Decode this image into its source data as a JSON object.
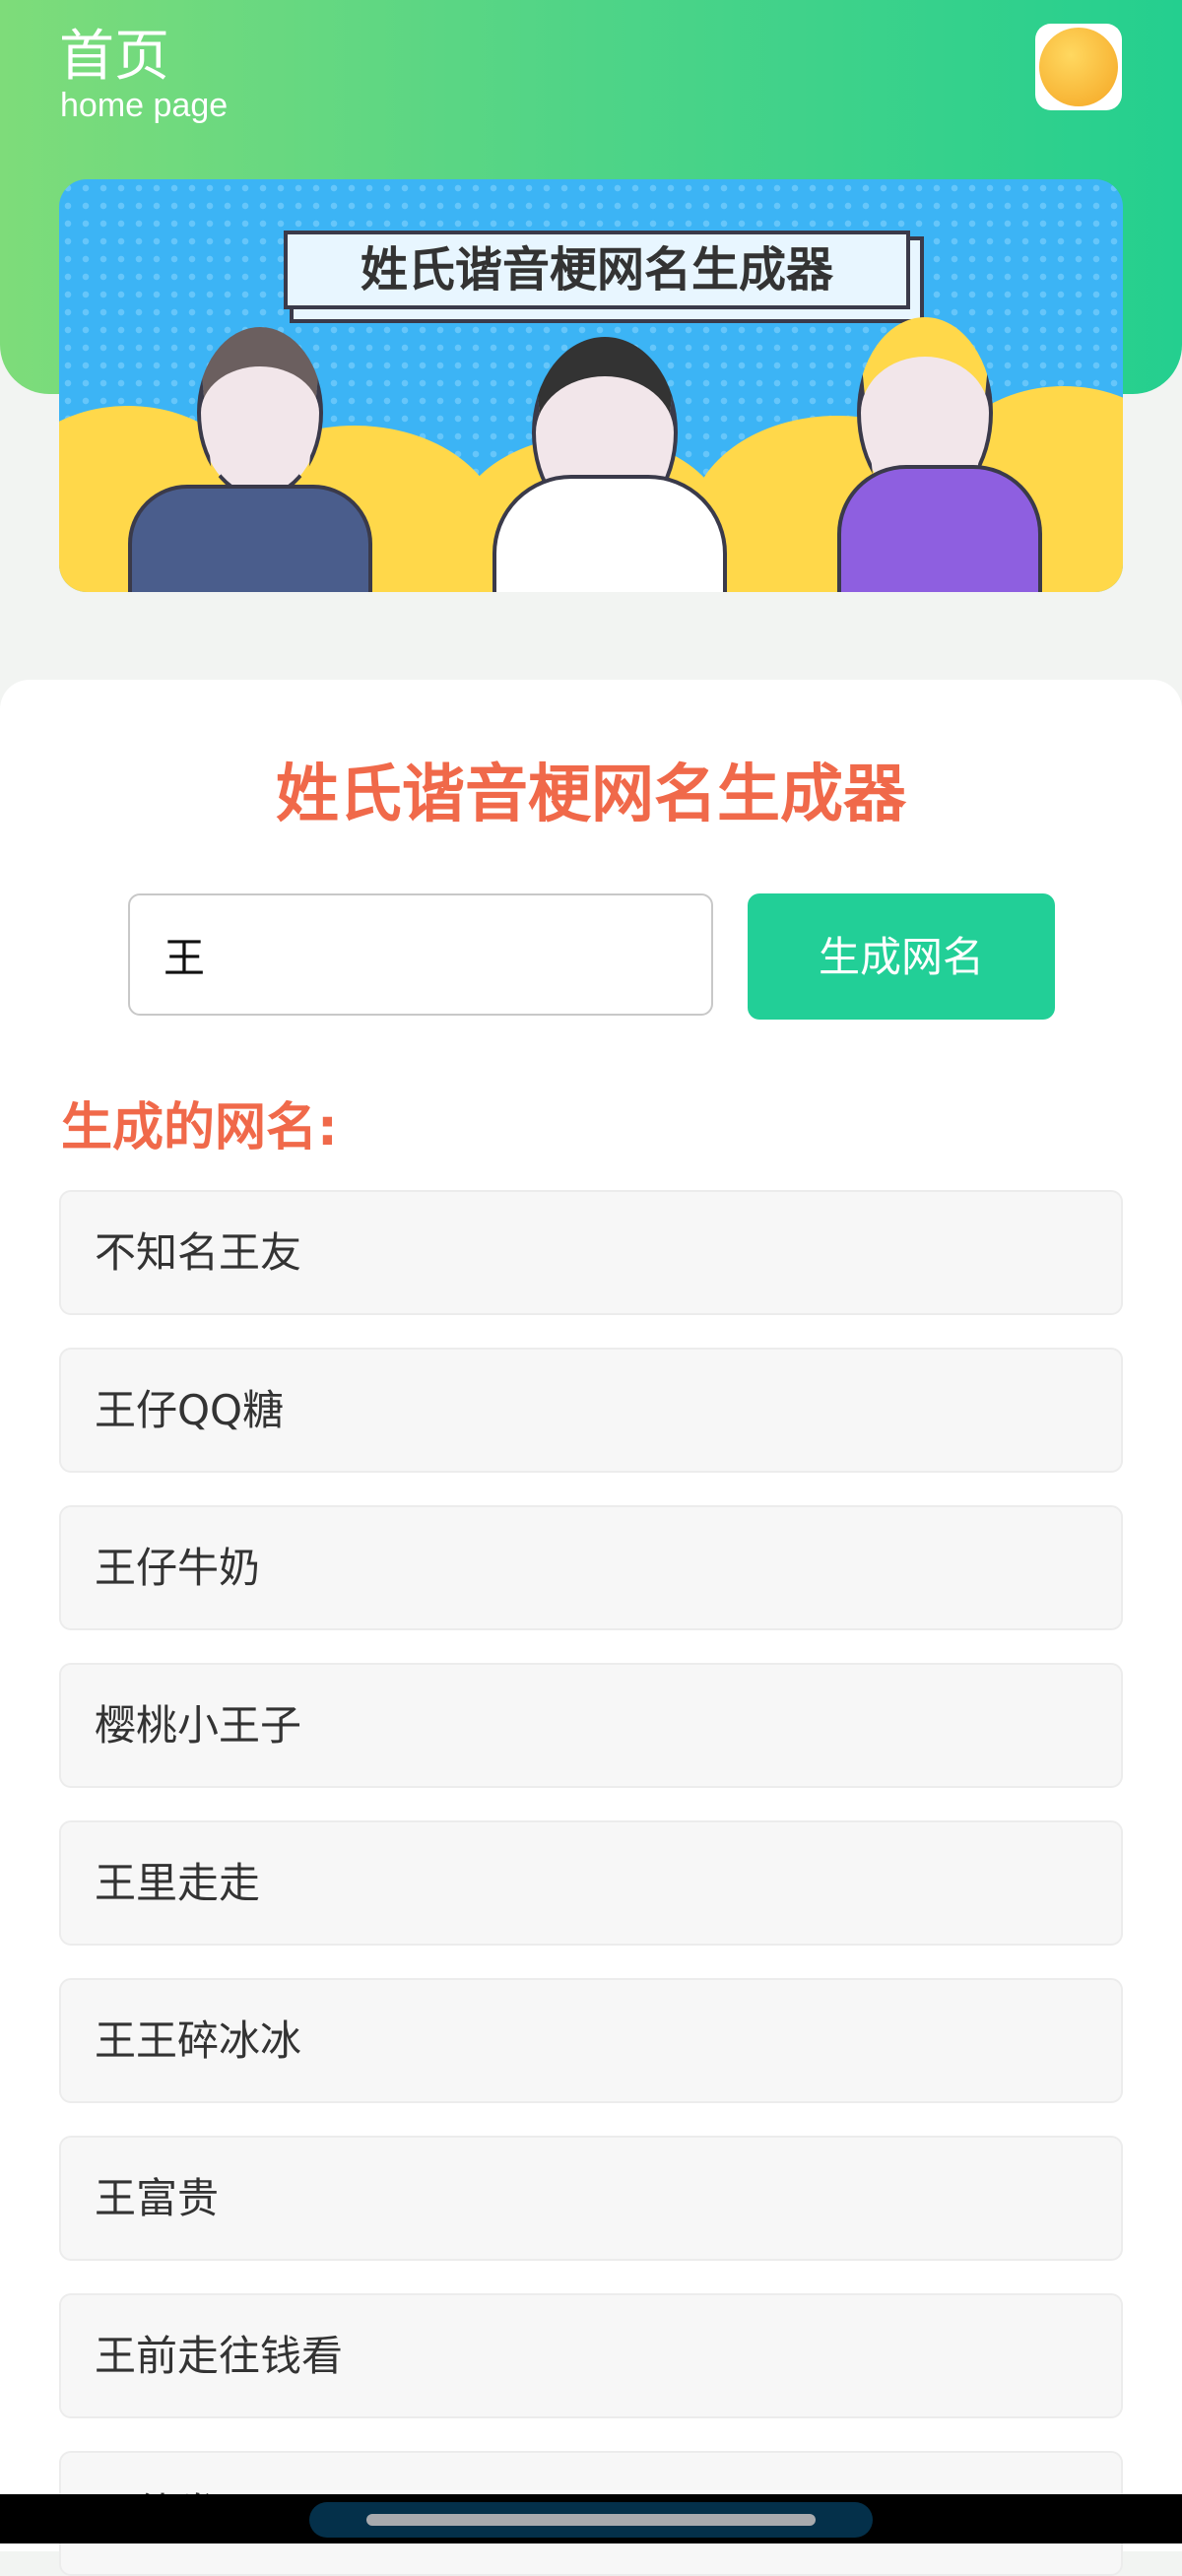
{
  "header": {
    "title": "首页",
    "subtitle": "home page",
    "avatar_icon": "angry-emoji-icon"
  },
  "banner": {
    "title": "姓氏谐音梗网名生成器"
  },
  "main": {
    "heading": "姓氏谐音梗网名生成器",
    "surname_input": {
      "value": "王"
    },
    "generate_button": "生成网名",
    "results_label": "生成的网名:",
    "results": [
      "不知名王友",
      "王仔QQ糖",
      "王仔牛奶",
      "樱桃小王子",
      "王里走走",
      "王王碎冰冰",
      "王富贵",
      "王前走往钱看",
      "王待发"
    ]
  },
  "colors": {
    "accent": "#f0694a",
    "button": "#22cf97",
    "header_start": "#7edc7a",
    "header_end": "#24cf8f"
  }
}
